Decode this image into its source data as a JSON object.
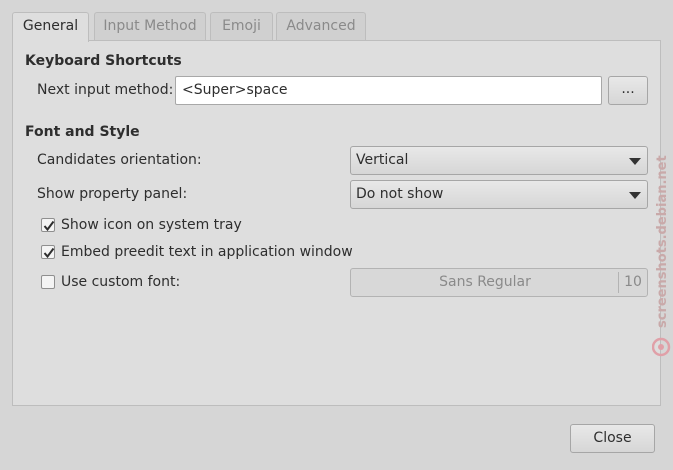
{
  "tabs": [
    {
      "label": "General",
      "active": true
    },
    {
      "label": "Input Method",
      "active": false
    },
    {
      "label": "Emoji",
      "active": false
    },
    {
      "label": "Advanced",
      "active": false
    }
  ],
  "keyboard_shortcuts": {
    "heading": "Keyboard Shortcuts",
    "next_input_method_label": "Next input method:",
    "next_input_method_value": "<Super>space",
    "browse_button_label": "..."
  },
  "font_and_style": {
    "heading": "Font and Style",
    "candidates_orientation_label": "Candidates orientation:",
    "candidates_orientation_value": "Vertical",
    "show_property_panel_label": "Show property panel:",
    "show_property_panel_value": "Do not show",
    "show_icon_label": "Show icon on system tray",
    "show_icon_checked": true,
    "embed_preedit_label": "Embed preedit text in application window",
    "embed_preedit_checked": true,
    "custom_font_label": "Use custom font:",
    "custom_font_checked": false,
    "font_name": "Sans Regular",
    "font_size": "10"
  },
  "footer": {
    "close_label": "Close"
  },
  "watermark": "screenshots.debian.net"
}
